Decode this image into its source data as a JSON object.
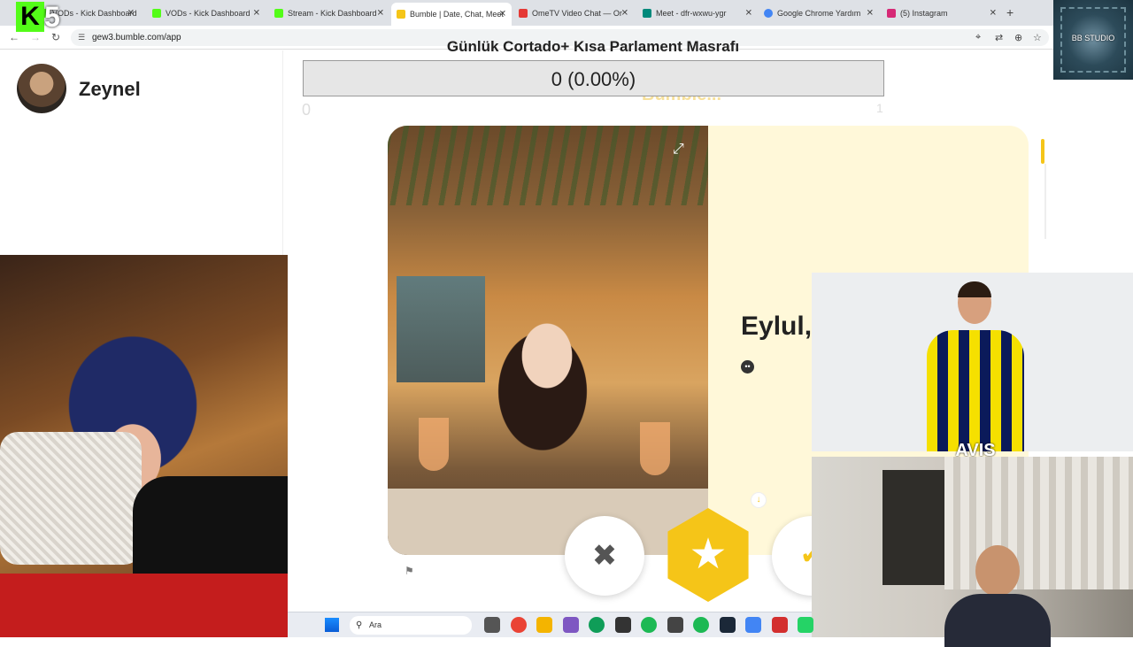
{
  "browser": {
    "tabs": [
      {
        "title": "VODs - Kick Dashboard",
        "active": false,
        "favicon_color": "#53fc18"
      },
      {
        "title": "VODs - Kick Dashboard",
        "active": false,
        "favicon_color": "#53fc18"
      },
      {
        "title": "Stream - Kick Dashboard",
        "active": false,
        "favicon_color": "#53fc18"
      },
      {
        "title": "Bumble | Date, Chat, Meet",
        "active": true,
        "favicon_color": "#f5c518"
      },
      {
        "title": "OmeTV Video Chat — Or",
        "active": false,
        "favicon_color": "#e53935"
      },
      {
        "title": "Meet - dfr-wxwu-ygr",
        "active": false,
        "favicon_color": "#00897b"
      },
      {
        "title": "Google Chrome Yardım",
        "active": false,
        "favicon_color": "#4285f4"
      },
      {
        "title": "(5) Instagram",
        "active": false,
        "favicon_color": "#d62976"
      }
    ],
    "url": "gew3.bumble.com/app"
  },
  "overlay": {
    "logo_k": "K",
    "logo_5": "5",
    "studio_label": "BB STUDIO",
    "title": "Günlük Cortado+ Kısa Parlament Masrafı",
    "counter": "0 (0.00%)",
    "counter_left": "0",
    "counter_right": "1"
  },
  "sidebar": {
    "username": "Zeynel"
  },
  "profile_card": {
    "ghost_text": "Bumble...",
    "name": "Eylul,",
    "icons": {
      "expand": "expand-icon",
      "verify": "verified-icon",
      "down": "chevron-down-icon",
      "flag": "flag-icon"
    }
  },
  "actions": {
    "pass_symbol": "✖",
    "superswipe_symbol": "★",
    "like_symbol": "✔"
  },
  "webcams": {
    "jersey_sponsor": "AVIS"
  },
  "taskbar": {
    "search_label": "Ara",
    "apps": [
      {
        "name": "file-viewer-app",
        "color": "#555555"
      },
      {
        "name": "chrome-app",
        "color": "#ea4335"
      },
      {
        "name": "file-explorer-app",
        "color": "#f4b400"
      },
      {
        "name": "copilot-app",
        "color": "#7e57c2"
      },
      {
        "name": "edge-app",
        "color": "#0f9d58"
      },
      {
        "name": "store-app",
        "color": "#333333"
      },
      {
        "name": "spotify-app",
        "color": "#1db954"
      },
      {
        "name": "steam-app",
        "color": "#444444"
      },
      {
        "name": "spotify-app-2",
        "color": "#1db954"
      },
      {
        "name": "steam-app-2",
        "color": "#1b2838"
      },
      {
        "name": "chrome-app-2",
        "color": "#4285f4"
      },
      {
        "name": "recorder-app",
        "color": "#d32f2f"
      },
      {
        "name": "whatsapp-app",
        "color": "#25d366"
      }
    ]
  }
}
